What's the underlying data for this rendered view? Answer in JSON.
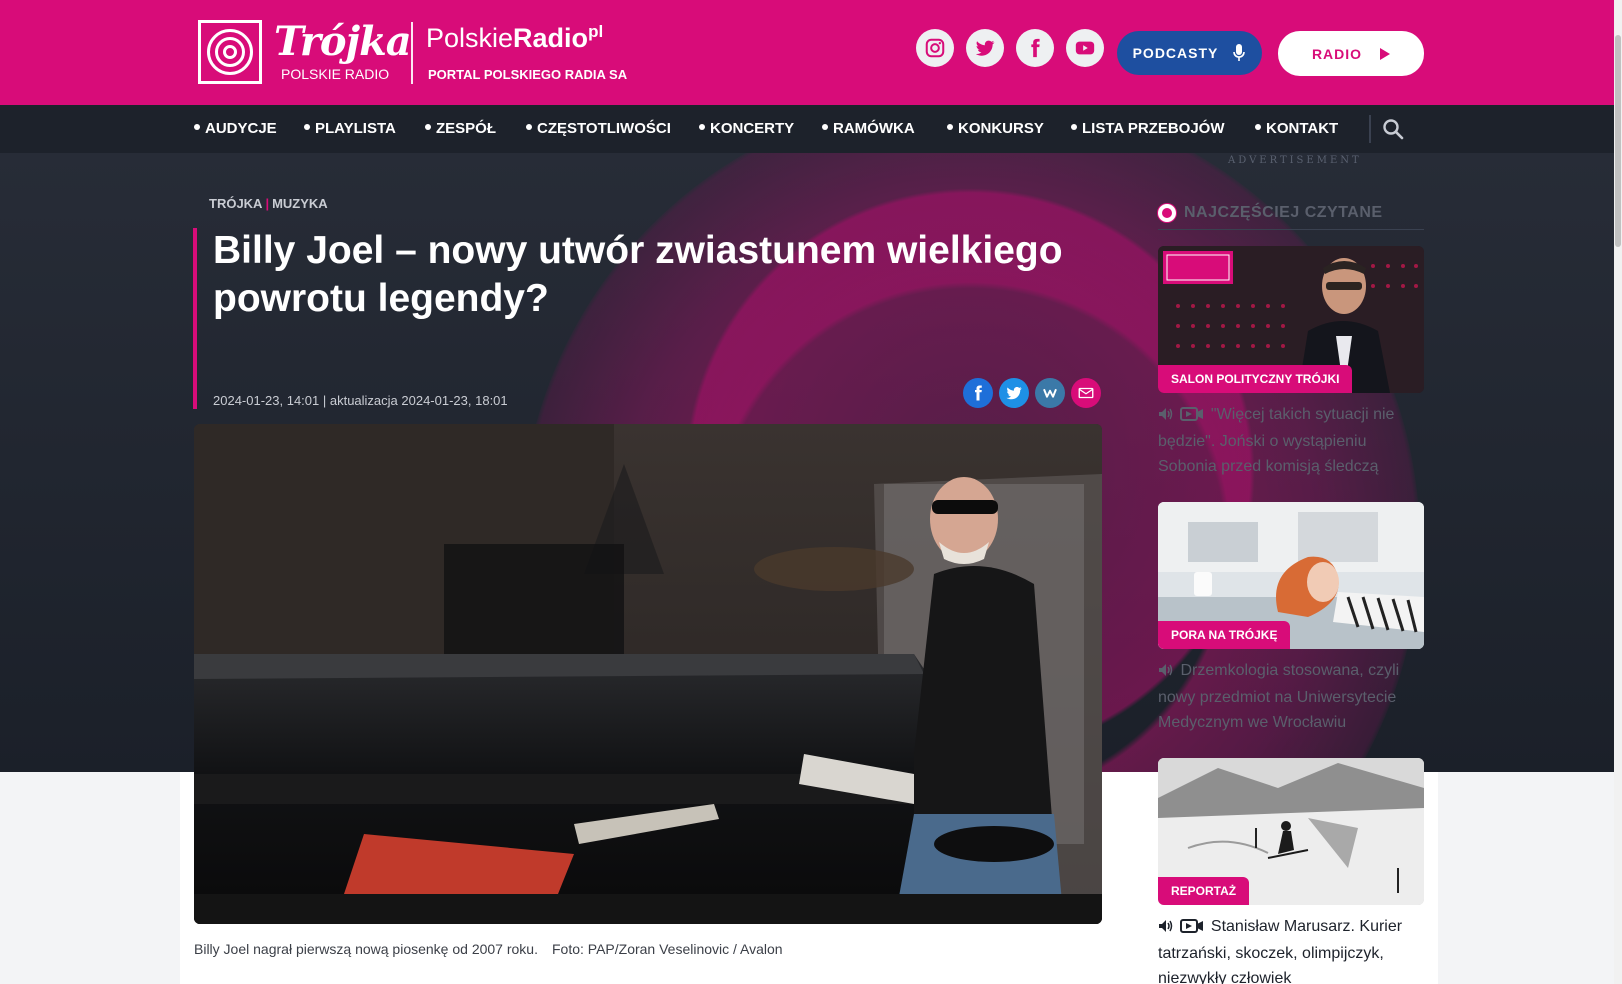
{
  "header": {
    "logo_name": "Trójka",
    "logo_sub": "POLSKIE RADIO",
    "portal_name_a": "Polskie",
    "portal_name_b": "Radio",
    "portal_name_sup": "pl",
    "portal_sub": "PORTAL POLSKIEGO RADIA SA",
    "social": [
      "instagram-icon",
      "twitter-icon",
      "facebook-icon",
      "youtube-icon"
    ],
    "podcasty_label": "PODCASTY",
    "radio_label": "RADIO"
  },
  "nav": {
    "items": [
      "AUDYCJE",
      "PLAYLISTA",
      "ZESPÓŁ",
      "CZĘSTOTLIWOŚCI",
      "KONCERTY",
      "RAMÓWKA",
      "KONKURSY",
      "LISTA PRZEBOJÓW",
      "KONTAKT"
    ]
  },
  "ad_label": "ADVERTISEMENT",
  "article": {
    "breadcrumb": [
      "TRÓJKA",
      "MUZYKA"
    ],
    "title": "Billy Joel – nowy utwór zwiastunem wielkiego powrotu legendy?",
    "date": "2024-01-23, 14:01 | aktualizacja 2024-01-23, 18:01",
    "caption": "Billy Joel nagrał pierwszą nową piosenkę od 2007 roku.",
    "photo_credit": "Foto: PAP/Zoran Veselinovic / Avalon"
  },
  "sidebar": {
    "heading": "NAJCZĘŚCIEJ CZYTANE",
    "cards": [
      {
        "tag": "SALON POLITYCZNY TRÓJKI",
        "title": "\"Więcej takich sytuacji nie będzie\". Joński o wystąpieniu Sobonia przed komisją śledczą"
      },
      {
        "tag": "PORA NA TRÓJKĘ",
        "title": "Drzemkologia stosowana, czyli nowy przedmiot na Uniwersytecie Medycznym we Wrocławiu"
      },
      {
        "tag": "REPORTAŻ",
        "title": "Stanisław Marusarz. Kurier tatrzański, skoczek, olimpijczyk, niezwykły człowiek"
      }
    ]
  },
  "colors": {
    "brand": "#d80c79",
    "nav": "#1d222b",
    "podcasty": "#1e4fa0"
  }
}
